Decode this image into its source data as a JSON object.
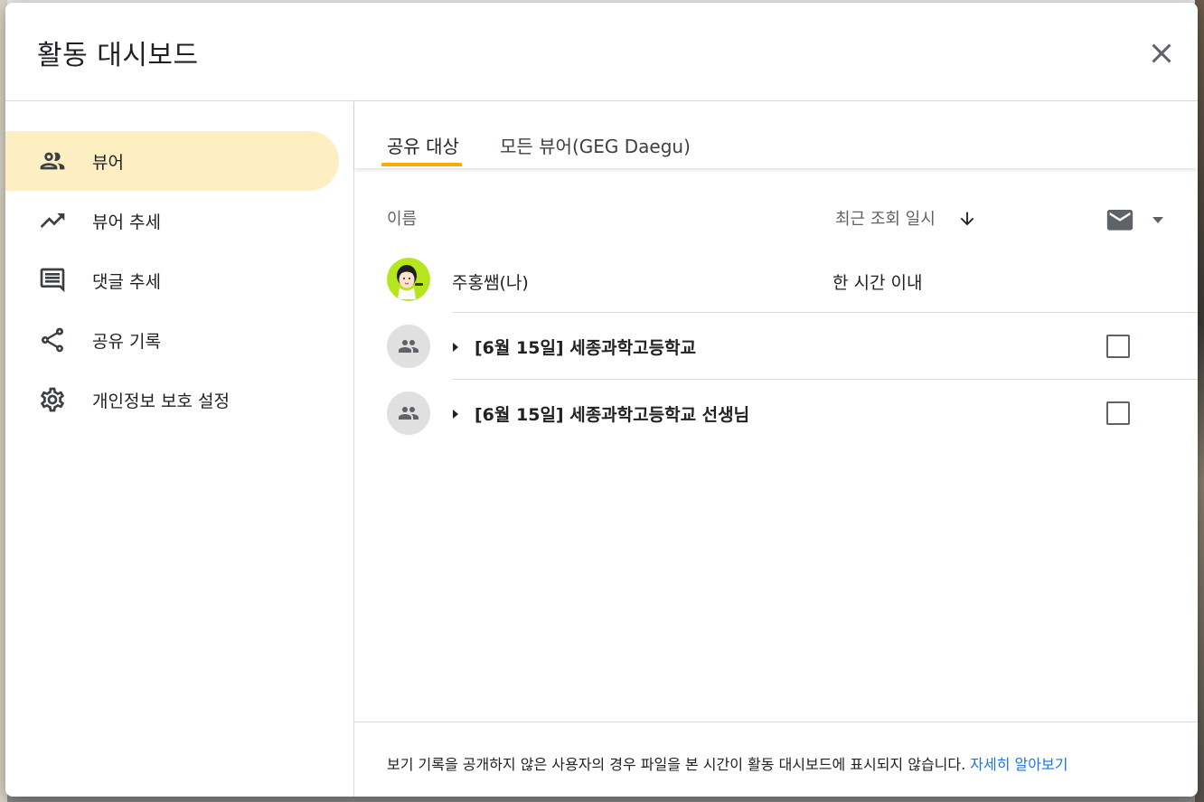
{
  "dialog": {
    "title": "활동 대시보드"
  },
  "sidebar": {
    "items": [
      {
        "label": "뷰어",
        "icon": "people-icon"
      },
      {
        "label": "뷰어 추세",
        "icon": "trending-up-icon"
      },
      {
        "label": "댓글 추세",
        "icon": "comment-icon"
      },
      {
        "label": "공유 기록",
        "icon": "share-icon"
      },
      {
        "label": "개인정보 보호 설정",
        "icon": "gear-icon"
      }
    ]
  },
  "tabs": [
    {
      "label": "공유 대상"
    },
    {
      "label": "모든 뷰어(GEG Daegu)"
    }
  ],
  "table": {
    "col_name": "이름",
    "col_time": "최근 조회 일시",
    "rows": [
      {
        "name": "주홍쌤(나)",
        "time": "한 시간 이내"
      },
      {
        "name": "[6월 15일] 세종과학고등학교"
      },
      {
        "name": "[6월 15일] 세종과학고등학교 선생님"
      }
    ]
  },
  "footer": {
    "text": "보기 기록을 공개하지 않은 사용자의 경우 파일을 본 시간이 활동 대시보드에 표시되지 않습니다. ",
    "link": "자세히 알아보기"
  },
  "colors": {
    "accent": "#f9ab00",
    "active_nav": "#feefc3",
    "link": "#1a73e8",
    "avatar_bg": "#b5e61d"
  }
}
